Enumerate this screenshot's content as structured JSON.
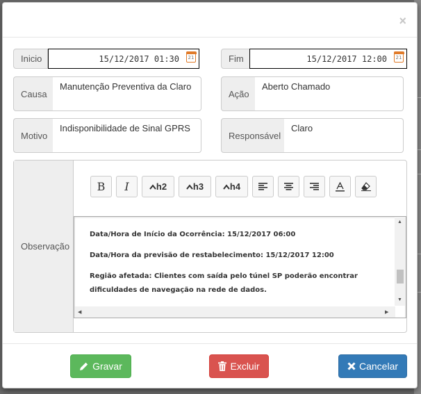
{
  "modal": {
    "close_label": "×"
  },
  "form": {
    "inicio": {
      "label": "Inicio",
      "value": "15/12/2017 01:30"
    },
    "fim": {
      "label": "Fim",
      "value": "15/12/2017 12:00"
    },
    "causa": {
      "label": "Causa",
      "value": "Manutenção Preventiva da Claro"
    },
    "acao": {
      "label": "Ação",
      "value": "Aberto Chamado"
    },
    "motivo": {
      "label": "Motivo",
      "value": "Indisponibilidade de Sinal GPRS"
    },
    "responsavel": {
      "label": "Responsável",
      "value": "Claro"
    },
    "calendar_icon_text": "21"
  },
  "observacao": {
    "label": "Observação",
    "toolbar": {
      "bold": "B",
      "italic": "I",
      "h2": "h2",
      "h3": "h3",
      "h4": "h4"
    },
    "content": {
      "line1": "Data/Hora de Início da Ocorrência: 15/12/2017 06:00",
      "line2": "Data/Hora da previsão de restabelecimento: 15/12/2017 12:00",
      "line3": "Região afetada: Clientes com saída pelo túnel SP poderão encontrar dificuldades de navegação na rede de dados."
    }
  },
  "footer": {
    "gravar": "Gravar",
    "excluir": "Excluir",
    "cancelar": "Cancelar"
  },
  "colors": {
    "gravar": "#5cb85c",
    "excluir": "#d9534f",
    "cancelar": "#337ab7",
    "calendar": "#e07b2a"
  }
}
